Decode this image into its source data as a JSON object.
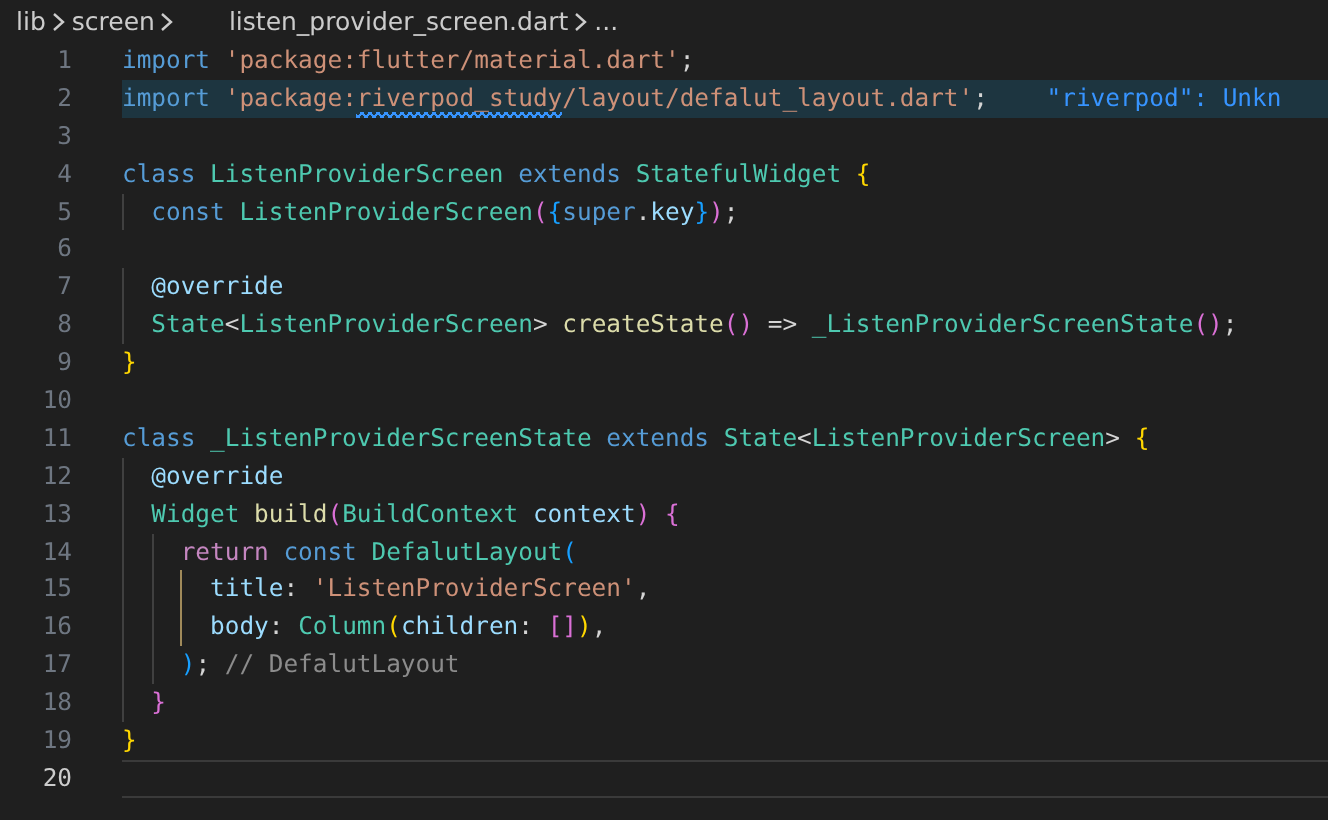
{
  "breadcrumb": [
    {
      "text": "lib"
    },
    {
      "text": "screen"
    },
    {
      "text": "listen_provider_screen.dart"
    },
    {
      "text": "..."
    }
  ],
  "lines": [
    {
      "number": "1",
      "highlighted": false,
      "current": false,
      "tokens": [
        {
          "t": "import",
          "kind": "keyword"
        },
        {
          "t": " 'package:flutter/material.dart'",
          "kind": "string"
        },
        {
          "t": ";",
          "kind": "plain"
        }
      ]
    },
    {
      "number": "2",
      "highlighted": true,
      "current": false,
      "tokens": [
        {
          "t": "import",
          "kind": "keyword"
        },
        {
          "t": " 'package:",
          "kind": "string"
        },
        {
          "t": "riverpod_study",
          "kind": "string",
          "error": true
        },
        {
          "t": "/layout/defalut_layout.dart'",
          "kind": "string"
        },
        {
          "t": ";",
          "kind": "plain"
        },
        {
          "t": "    \"riverpod\": Unkn",
          "kind": "diagnostic"
        }
      ]
    },
    {
      "number": "3",
      "highlighted": false,
      "current": false
    },
    {
      "number": "4",
      "highlighted": false,
      "current": false,
      "tokens": [
        {
          "t": "class",
          "kind": "keyword"
        },
        {
          "t": " ListenProviderScreen ",
          "kind": "type"
        },
        {
          "t": "extends",
          "kind": "keyword"
        },
        {
          "t": " StatefulWidget ",
          "kind": "type"
        },
        {
          "t": "{",
          "kind": "bracket1"
        }
      ]
    },
    {
      "number": "5",
      "highlighted": false,
      "current": false,
      "tokens": [
        {
          "t": "  const",
          "kind": "keyword"
        },
        {
          "t": " ListenProviderScreen",
          "kind": "type"
        },
        {
          "t": "(",
          "kind": "bracket2"
        },
        {
          "t": "{",
          "kind": "bracket3"
        },
        {
          "t": "super",
          "kind": "keyword"
        },
        {
          "t": ".",
          "kind": "plain"
        },
        {
          "t": "key",
          "kind": "variable"
        },
        {
          "t": "}",
          "kind": "bracket3"
        },
        {
          "t": ")",
          "kind": "bracket2"
        },
        {
          "t": ";",
          "kind": "plain"
        }
      ]
    },
    {
      "number": "6",
      "highlighted": false,
      "current": false
    },
    {
      "number": "7",
      "highlighted": false,
      "current": false,
      "tokens": [
        {
          "t": "  @override",
          "kind": "variable"
        }
      ]
    },
    {
      "number": "8",
      "highlighted": false,
      "current": false,
      "tokens": [
        {
          "t": "  State",
          "kind": "type"
        },
        {
          "t": "<",
          "kind": "plain"
        },
        {
          "t": "ListenProviderScreen",
          "kind": "type"
        },
        {
          "t": "> ",
          "kind": "plain"
        },
        {
          "t": "createState",
          "kind": "function"
        },
        {
          "t": "()",
          "kind": "bracket2"
        },
        {
          "t": " => ",
          "kind": "plain"
        },
        {
          "t": "_ListenProviderScreenState",
          "kind": "type"
        },
        {
          "t": "()",
          "kind": "bracket2"
        },
        {
          "t": ";",
          "kind": "plain"
        }
      ]
    },
    {
      "number": "9",
      "highlighted": false,
      "current": false,
      "tokens": [
        {
          "t": "}",
          "kind": "bracket1"
        }
      ]
    },
    {
      "number": "10",
      "highlighted": false,
      "current": false
    },
    {
      "number": "11",
      "highlighted": false,
      "current": false,
      "tokens": [
        {
          "t": "class",
          "kind": "keyword"
        },
        {
          "t": " _ListenProviderScreenState ",
          "kind": "type"
        },
        {
          "t": "extends",
          "kind": "keyword"
        },
        {
          "t": " State",
          "kind": "type"
        },
        {
          "t": "<",
          "kind": "plain"
        },
        {
          "t": "ListenProviderScreen",
          "kind": "type"
        },
        {
          "t": "> ",
          "kind": "plain"
        },
        {
          "t": "{",
          "kind": "bracket1"
        }
      ]
    },
    {
      "number": "12",
      "highlighted": false,
      "current": false,
      "tokens": [
        {
          "t": "  @override",
          "kind": "variable"
        }
      ]
    },
    {
      "number": "13",
      "highlighted": false,
      "current": false,
      "tokens": [
        {
          "t": "  Widget ",
          "kind": "type"
        },
        {
          "t": "build",
          "kind": "function"
        },
        {
          "t": "(",
          "kind": "bracket2"
        },
        {
          "t": "BuildContext ",
          "kind": "type"
        },
        {
          "t": "context",
          "kind": "variable"
        },
        {
          "t": ")",
          "kind": "bracket2"
        },
        {
          "t": " {",
          "kind": "bracket2"
        }
      ]
    },
    {
      "number": "14",
      "highlighted": false,
      "current": false,
      "tokens": [
        {
          "t": "    return",
          "kind": "control"
        },
        {
          "t": " const",
          "kind": "keyword"
        },
        {
          "t": " DefalutLayout",
          "kind": "type"
        },
        {
          "t": "(",
          "kind": "bracket3"
        }
      ]
    },
    {
      "number": "15",
      "highlighted": false,
      "current": false,
      "guide": true,
      "tokens": [
        {
          "t": "      title",
          "kind": "variable"
        },
        {
          "t": ": ",
          "kind": "plain"
        },
        {
          "t": "'ListenProviderScreen'",
          "kind": "string"
        },
        {
          "t": ",",
          "kind": "plain"
        }
      ]
    },
    {
      "number": "16",
      "highlighted": false,
      "current": false,
      "guide": true,
      "tokens": [
        {
          "t": "      body",
          "kind": "variable"
        },
        {
          "t": ": ",
          "kind": "plain"
        },
        {
          "t": "Column",
          "kind": "type"
        },
        {
          "t": "(",
          "kind": "bracket1"
        },
        {
          "t": "children",
          "kind": "variable"
        },
        {
          "t": ": ",
          "kind": "plain"
        },
        {
          "t": "[]",
          "kind": "bracket2"
        },
        {
          "t": ")",
          "kind": "bracket1"
        },
        {
          "t": ",",
          "kind": "plain"
        }
      ]
    },
    {
      "number": "17",
      "highlighted": false,
      "current": false,
      "tokens": [
        {
          "t": "    )",
          "kind": "bracket3"
        },
        {
          "t": "; ",
          "kind": "plain"
        },
        {
          "t": "// DefalutLayout",
          "kind": "comment"
        }
      ]
    },
    {
      "number": "18",
      "highlighted": false,
      "current": false,
      "tokens": [
        {
          "t": "  }",
          "kind": "bracket2"
        }
      ]
    },
    {
      "number": "19",
      "highlighted": false,
      "current": false,
      "tokens": [
        {
          "t": "}",
          "kind": "bracket1"
        }
      ]
    },
    {
      "number": "20",
      "highlighted": false,
      "current": true
    }
  ]
}
